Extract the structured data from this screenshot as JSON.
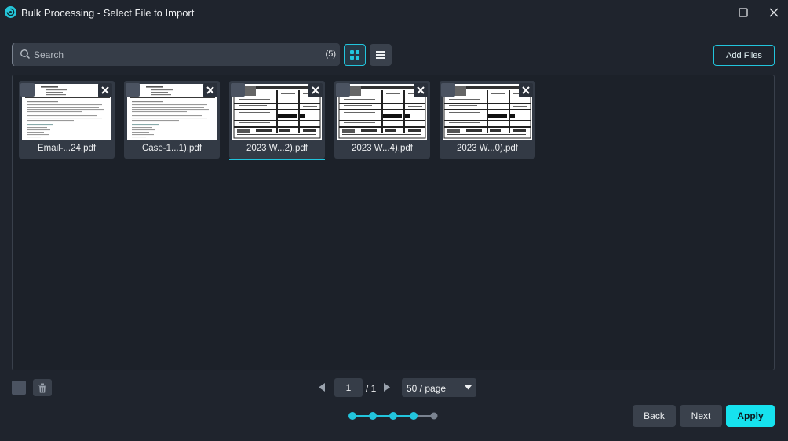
{
  "window": {
    "title": "Bulk Processing - Select File to Import",
    "icons": {
      "logo": "app-logo-icon",
      "maximize": "maximize-icon",
      "close": "close-icon"
    }
  },
  "toolbar": {
    "search_placeholder": "Search",
    "search_value": "",
    "count": "(5)",
    "add_files_label": "Add Files",
    "view_mode": "grid"
  },
  "files": [
    {
      "name": "Email-...24.pdf",
      "doc_type": "letter",
      "selected": false,
      "active": false
    },
    {
      "name": "Case-1...1).pdf",
      "doc_type": "letter",
      "selected": false,
      "active": false
    },
    {
      "name": "2023 W...2).pdf",
      "doc_type": "form",
      "selected": false,
      "active": true
    },
    {
      "name": "2023 W...4).pdf",
      "doc_type": "form",
      "selected": false,
      "active": false
    },
    {
      "name": "2023 W...0).pdf",
      "doc_type": "form",
      "selected": false,
      "active": false
    }
  ],
  "pagination": {
    "current_page": "1",
    "total": "/ 1",
    "per_page": "50 / page"
  },
  "stepper": {
    "total_steps": 5,
    "completed_steps": 4
  },
  "buttons": {
    "back": "Back",
    "next": "Next",
    "apply": "Apply"
  },
  "colors": {
    "accent": "#22c5dd",
    "apply": "#16e2ee",
    "background": "#1f242d"
  }
}
